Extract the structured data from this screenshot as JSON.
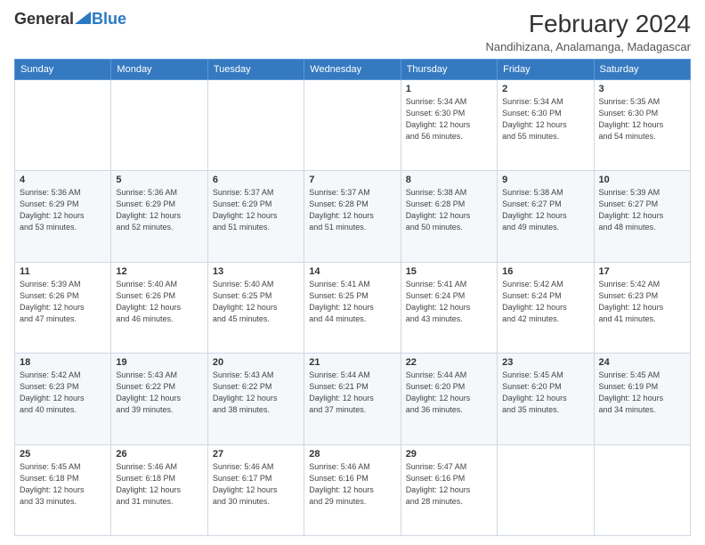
{
  "logo": {
    "general": "General",
    "blue": "Blue"
  },
  "title": "February 2024",
  "subtitle": "Nandihizana, Analamanga, Madagascar",
  "days_of_week": [
    "Sunday",
    "Monday",
    "Tuesday",
    "Wednesday",
    "Thursday",
    "Friday",
    "Saturday"
  ],
  "weeks": [
    [
      {
        "day": "",
        "detail": ""
      },
      {
        "day": "",
        "detail": ""
      },
      {
        "day": "",
        "detail": ""
      },
      {
        "day": "",
        "detail": ""
      },
      {
        "day": "1",
        "detail": "Sunrise: 5:34 AM\nSunset: 6:30 PM\nDaylight: 12 hours\nand 56 minutes."
      },
      {
        "day": "2",
        "detail": "Sunrise: 5:34 AM\nSunset: 6:30 PM\nDaylight: 12 hours\nand 55 minutes."
      },
      {
        "day": "3",
        "detail": "Sunrise: 5:35 AM\nSunset: 6:30 PM\nDaylight: 12 hours\nand 54 minutes."
      }
    ],
    [
      {
        "day": "4",
        "detail": "Sunrise: 5:36 AM\nSunset: 6:29 PM\nDaylight: 12 hours\nand 53 minutes."
      },
      {
        "day": "5",
        "detail": "Sunrise: 5:36 AM\nSunset: 6:29 PM\nDaylight: 12 hours\nand 52 minutes."
      },
      {
        "day": "6",
        "detail": "Sunrise: 5:37 AM\nSunset: 6:29 PM\nDaylight: 12 hours\nand 51 minutes."
      },
      {
        "day": "7",
        "detail": "Sunrise: 5:37 AM\nSunset: 6:28 PM\nDaylight: 12 hours\nand 51 minutes."
      },
      {
        "day": "8",
        "detail": "Sunrise: 5:38 AM\nSunset: 6:28 PM\nDaylight: 12 hours\nand 50 minutes."
      },
      {
        "day": "9",
        "detail": "Sunrise: 5:38 AM\nSunset: 6:27 PM\nDaylight: 12 hours\nand 49 minutes."
      },
      {
        "day": "10",
        "detail": "Sunrise: 5:39 AM\nSunset: 6:27 PM\nDaylight: 12 hours\nand 48 minutes."
      }
    ],
    [
      {
        "day": "11",
        "detail": "Sunrise: 5:39 AM\nSunset: 6:26 PM\nDaylight: 12 hours\nand 47 minutes."
      },
      {
        "day": "12",
        "detail": "Sunrise: 5:40 AM\nSunset: 6:26 PM\nDaylight: 12 hours\nand 46 minutes."
      },
      {
        "day": "13",
        "detail": "Sunrise: 5:40 AM\nSunset: 6:25 PM\nDaylight: 12 hours\nand 45 minutes."
      },
      {
        "day": "14",
        "detail": "Sunrise: 5:41 AM\nSunset: 6:25 PM\nDaylight: 12 hours\nand 44 minutes."
      },
      {
        "day": "15",
        "detail": "Sunrise: 5:41 AM\nSunset: 6:24 PM\nDaylight: 12 hours\nand 43 minutes."
      },
      {
        "day": "16",
        "detail": "Sunrise: 5:42 AM\nSunset: 6:24 PM\nDaylight: 12 hours\nand 42 minutes."
      },
      {
        "day": "17",
        "detail": "Sunrise: 5:42 AM\nSunset: 6:23 PM\nDaylight: 12 hours\nand 41 minutes."
      }
    ],
    [
      {
        "day": "18",
        "detail": "Sunrise: 5:42 AM\nSunset: 6:23 PM\nDaylight: 12 hours\nand 40 minutes."
      },
      {
        "day": "19",
        "detail": "Sunrise: 5:43 AM\nSunset: 6:22 PM\nDaylight: 12 hours\nand 39 minutes."
      },
      {
        "day": "20",
        "detail": "Sunrise: 5:43 AM\nSunset: 6:22 PM\nDaylight: 12 hours\nand 38 minutes."
      },
      {
        "day": "21",
        "detail": "Sunrise: 5:44 AM\nSunset: 6:21 PM\nDaylight: 12 hours\nand 37 minutes."
      },
      {
        "day": "22",
        "detail": "Sunrise: 5:44 AM\nSunset: 6:20 PM\nDaylight: 12 hours\nand 36 minutes."
      },
      {
        "day": "23",
        "detail": "Sunrise: 5:45 AM\nSunset: 6:20 PM\nDaylight: 12 hours\nand 35 minutes."
      },
      {
        "day": "24",
        "detail": "Sunrise: 5:45 AM\nSunset: 6:19 PM\nDaylight: 12 hours\nand 34 minutes."
      }
    ],
    [
      {
        "day": "25",
        "detail": "Sunrise: 5:45 AM\nSunset: 6:18 PM\nDaylight: 12 hours\nand 33 minutes."
      },
      {
        "day": "26",
        "detail": "Sunrise: 5:46 AM\nSunset: 6:18 PM\nDaylight: 12 hours\nand 31 minutes."
      },
      {
        "day": "27",
        "detail": "Sunrise: 5:46 AM\nSunset: 6:17 PM\nDaylight: 12 hours\nand 30 minutes."
      },
      {
        "day": "28",
        "detail": "Sunrise: 5:46 AM\nSunset: 6:16 PM\nDaylight: 12 hours\nand 29 minutes."
      },
      {
        "day": "29",
        "detail": "Sunrise: 5:47 AM\nSunset: 6:16 PM\nDaylight: 12 hours\nand 28 minutes."
      },
      {
        "day": "",
        "detail": ""
      },
      {
        "day": "",
        "detail": ""
      }
    ]
  ]
}
